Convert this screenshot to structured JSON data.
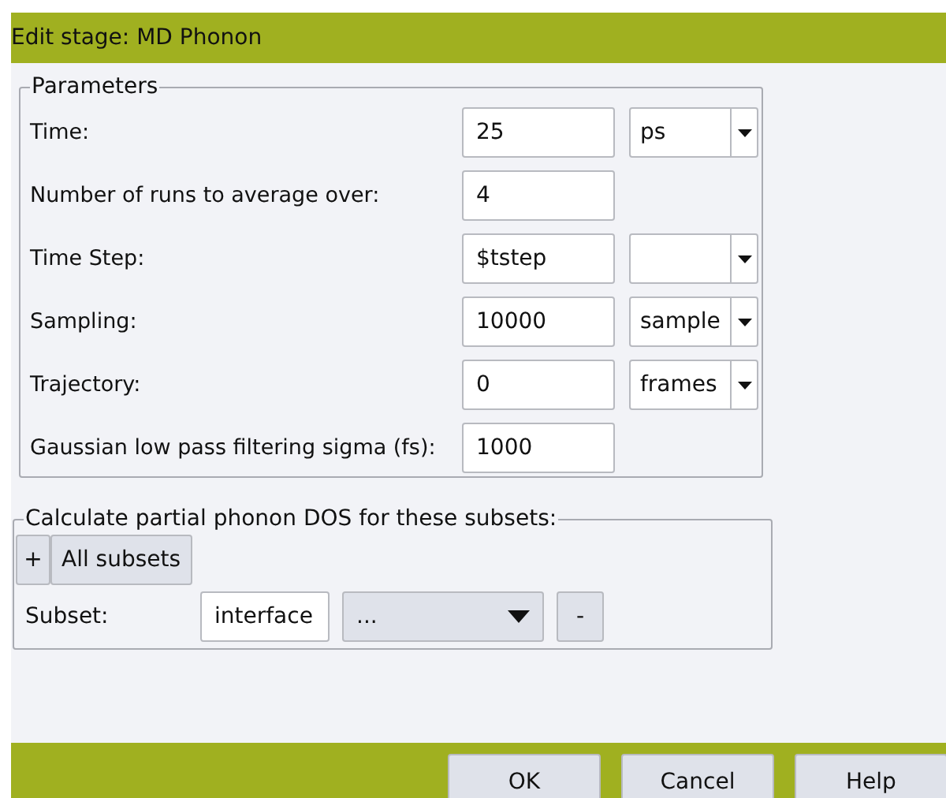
{
  "window": {
    "title": "Edit stage: MD Phonon"
  },
  "parameters": {
    "legend": "Parameters",
    "rows": [
      {
        "kind": "field-unit",
        "label": "Time:",
        "value": "25",
        "unit": "ps"
      },
      {
        "kind": "field",
        "label": "Number of runs to average over:",
        "value": "4"
      },
      {
        "kind": "field-unit",
        "label": "Time Step:",
        "value": "$tstep"
      },
      {
        "kind": "field-unit",
        "label": "Sampling:",
        "value": "10000",
        "unit": "sample"
      },
      {
        "kind": "field-unit",
        "label": "Trajectory:",
        "value": "0",
        "unit": "frames"
      },
      {
        "kind": "field",
        "label": "Gaussian low pass filtering sigma (fs):",
        "value": "1000"
      }
    ]
  },
  "subsets": {
    "legend": "Calculate partial phonon DOS for these subsets:",
    "add_button": "+",
    "all_button": "All subsets",
    "rows": [
      {
        "label": "Subset:",
        "value": "interface",
        "choice": "...",
        "remove_button": "-"
      }
    ]
  },
  "buttons": [
    "OK",
    "Cancel",
    "Help"
  ]
}
